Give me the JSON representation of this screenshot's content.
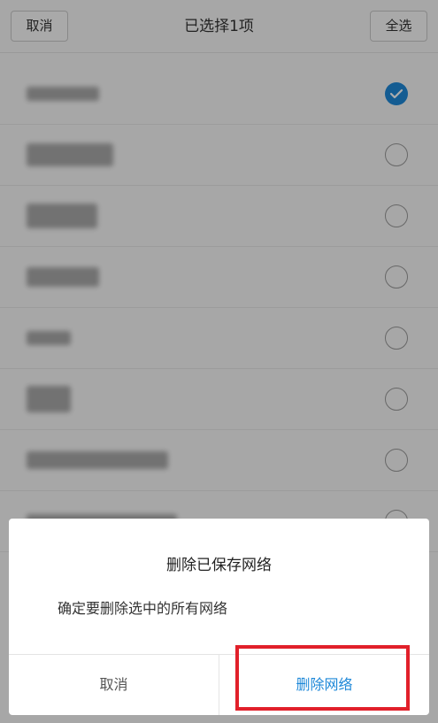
{
  "topbar": {
    "cancel_label": "取消",
    "title": "已选择1项",
    "select_all_label": "全选"
  },
  "networks": [
    {
      "checked": true
    },
    {
      "checked": false
    },
    {
      "checked": false
    },
    {
      "checked": false
    },
    {
      "checked": false
    },
    {
      "checked": false
    },
    {
      "checked": false
    },
    {
      "checked": false
    }
  ],
  "dialog": {
    "title": "删除已保存网络",
    "message": "确定要删除选中的所有网络",
    "cancel_label": "取消",
    "confirm_label": "删除网络"
  },
  "colors": {
    "accent": "#1e88d8",
    "highlight": "#e1202a"
  }
}
